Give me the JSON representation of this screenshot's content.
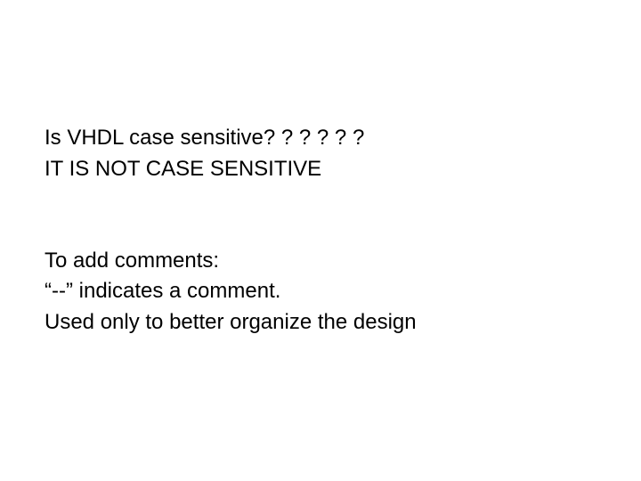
{
  "block1": {
    "line1": "Is VHDL case sensitive? ? ? ? ? ?",
    "line2": "IT IS NOT CASE SENSITIVE"
  },
  "block2": {
    "line1": "To add comments:",
    "line2": "“--” indicates a comment.",
    "line3": "Used only to better organize the design"
  }
}
